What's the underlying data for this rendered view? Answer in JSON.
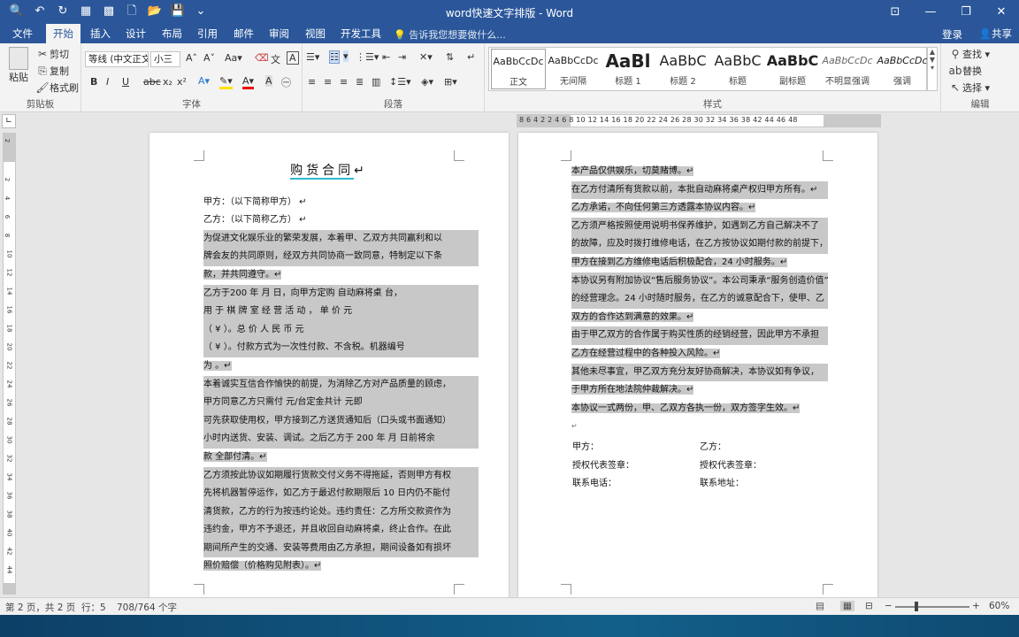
{
  "window": {
    "title": "word快速文字排版 - Word",
    "controls": [
      "⊡",
      "—",
      "❐",
      "✕"
    ]
  },
  "qat": [
    "🔍",
    "↶",
    "↻",
    "▦",
    "▩",
    "🗋",
    "📂",
    "💾",
    "⌄"
  ],
  "menu": {
    "tabs": [
      "文件",
      "开始",
      "插入",
      "设计",
      "布局",
      "引用",
      "邮件",
      "审阅",
      "视图",
      "开发工具"
    ],
    "active": "开始",
    "tellme": "告诉我您想要做什么...",
    "signin": "登录",
    "share": "共享"
  },
  "ribbon": {
    "clipboard": {
      "paste": "粘贴",
      "cut": "剪切",
      "copy": "复制",
      "format_painter": "格式刷",
      "label": "剪贴板"
    },
    "font": {
      "font_name": "等线 (中文正文)",
      "font_size": "小三",
      "label": "字体",
      "buttons": [
        "B",
        "I",
        "U",
        "abc",
        "x₂",
        "x²"
      ]
    },
    "paragraph": {
      "label": "段落"
    },
    "styles": {
      "label": "样式",
      "items": [
        {
          "preview": "AaBbCcDc",
          "name": "正文"
        },
        {
          "preview": "AaBbCcDc",
          "name": "无间隔"
        },
        {
          "preview": "AaBl",
          "name": "标题 1"
        },
        {
          "preview": "AaBbC",
          "name": "标题 2"
        },
        {
          "preview": "AaBbC",
          "name": "标题"
        },
        {
          "preview": "AaBbC",
          "name": "副标题"
        },
        {
          "preview": "AaBbCcDc",
          "name": "不明显强调"
        },
        {
          "preview": "AaBbCcDc",
          "name": "强调"
        }
      ]
    },
    "editing": {
      "find": "查找",
      "replace": "替换",
      "select": "选择",
      "label": "编辑"
    }
  },
  "ruler": {
    "numbers": "8  6  4  2     2   4   6   8  10  12  14  16  18  20  22  24  26  28  30  32  34  36  38      42  44  46  48",
    "vnumbers": [
      "2",
      "2",
      "4",
      "6",
      "8",
      "10",
      "12",
      "14",
      "16",
      "18",
      "20",
      "22",
      "24",
      "26",
      "28",
      "30",
      "32",
      "34",
      "36",
      "38",
      "40",
      "42",
      "44"
    ]
  },
  "page1": {
    "title": "购货合同",
    "lines": [
      "",
      "甲方：（以下简称甲方）                                    ↵",
      "乙方：（以下简称乙方）                                    ↵",
      "为促进文化娱乐业的繁荣发展，本着甲、乙双方共同赢利和以",
      "牌会友的共同原则，经双方共同协商一致同意，特制定以下条",
      "款，并共同遵守。↵",
      "乙方于200     年    月    日，向甲方定购          自动麻将桌      台，",
      "用 于 棋 牌 室 经 营 活 动 ， 单 价                                    元",
      "（ ¥                         ）。总 价 人 民 币                          元",
      "（ ¥              ）。付款方式为一次性付款、不含税。机器编号",
      "为                             。↵",
      "本着诚实互信合作愉快的前提，为消除乙方对产品质量的顾虑，",
      "甲方同意乙方只需付                  元/台定金共计                  元即",
      "可先获取使用权，甲方接到乙方送货通知后（口头或书面通知）",
      "小时内送货、安装、调试。之后乙方于 200    年    月    日前将余",
      "款            全部付清。↵",
      "乙方须按此协议如期履行货款交付义务不得拖延，否则甲方有权",
      "先将机器暂停运作，如乙方于最迟付款期限后 10 日内仍不能付",
      "清货款，乙方的行为按违约论处。违约责任：乙方所交款资作为",
      "违约金，甲方不予退还，并且收回自动麻将桌，终止合作。在此",
      "期间所产生的交通、安装等费用由乙方承担，期间设备如有损坏",
      "照价赔偿（价格购见附表）。↵"
    ]
  },
  "page2": {
    "lines": [
      "本产品仅供娱乐，切莫赌博。↵",
      "在乙方付清所有货款以前，本批自动麻将桌产权归甲方所有。↵",
      "乙方承诺，不向任何第三方透露本协议内容。↵",
      "乙方须严格按照使用说明书保养维护，如遇到乙方自己解决不了",
      "的故障，应及时拨打维修电话，在乙方按协议如期付款的前提下，",
      "甲方在接到乙方维修电话后积极配合，24 小时服务。↵",
      "本协议另有附加协议“售后服务协议”。本公司秉承“服务创造价值”",
      "的经营理念。24 小时随时服务，在乙方的诚意配合下，使甲、乙",
      "双方的合作达到满意的效果。↵",
      "由于甲乙双方的合作属于购买性质的经销经营，因此甲方不承担",
      "乙方在经营过程中的各种投入风险。↵",
      "其他未尽事宜，甲乙双方充分友好协商解决，本协议如有争议，",
      "于甲方所在地法院仲裁解决。↵",
      "本协议一式两份，甲、乙双方各执一份，双方签字生效。↵",
      "↵"
    ],
    "sign": [
      {
        "left": "甲方：",
        "right": "乙方："
      },
      {
        "left": "授权代表签章：",
        "right": "授权代表签章："
      },
      {
        "left": "联系电话：",
        "right": "联系地址："
      }
    ]
  },
  "status": {
    "page": "第 2 页，共 2 页",
    "line": "行：5",
    "words": "708/764 个字",
    "zoom": "60%"
  }
}
